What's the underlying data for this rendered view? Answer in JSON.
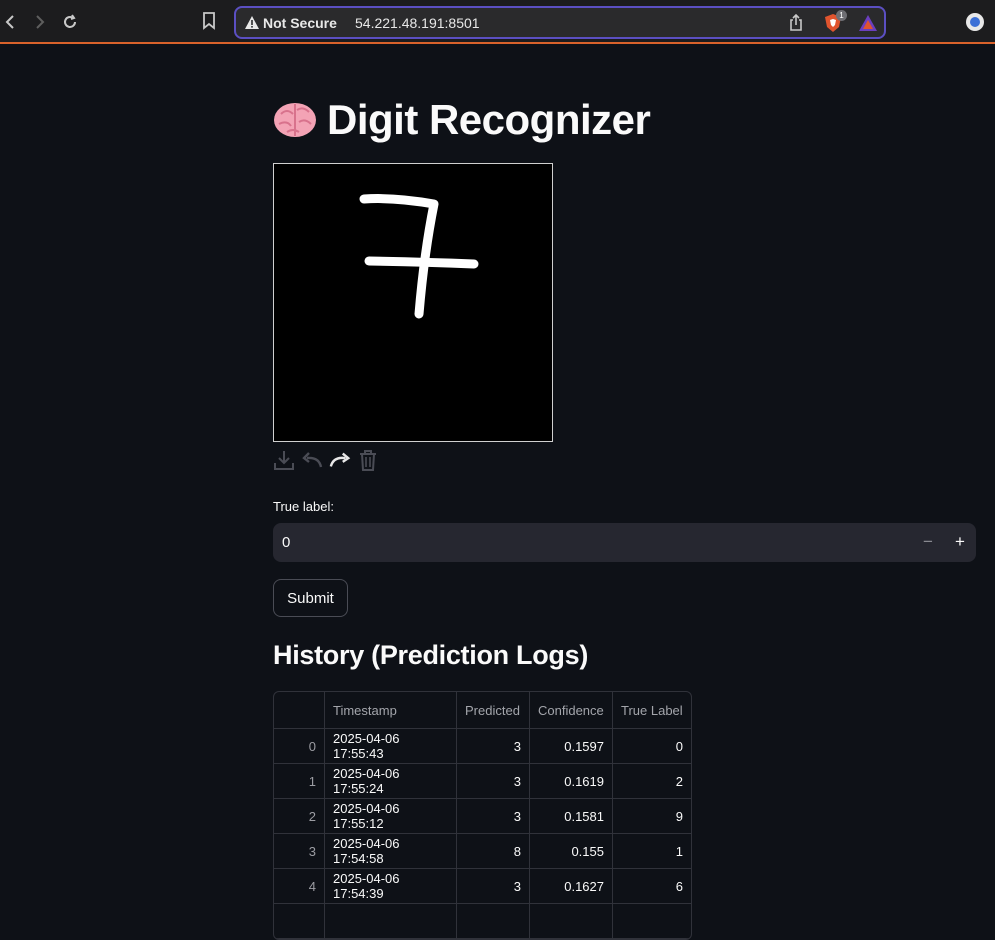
{
  "browser": {
    "security_label": "Not Secure",
    "url": "54.221.48.191:8501",
    "shield_count": "1",
    "accent": "#d9622b"
  },
  "app": {
    "title": "Digit Recognizer",
    "title_icon": "brain-emoji-icon",
    "canvas": {
      "background": "#000000",
      "stroke_color": "#ffffff",
      "drawn_digit": "7"
    },
    "canvas_tools": [
      "download-icon",
      "undo-icon",
      "redo-icon",
      "trash-icon"
    ],
    "true_label": {
      "label": "True label:",
      "value": "0",
      "minus": "−",
      "plus": "+"
    },
    "submit_label": "Submit",
    "history_title": "History (Prediction Logs)",
    "table": {
      "columns": [
        "",
        "Timestamp",
        "Predicted",
        "Confidence",
        "True Label"
      ],
      "rows": [
        [
          "0",
          "2025-04-06 17:55:43",
          "3",
          "0.1597",
          "0"
        ],
        [
          "1",
          "2025-04-06 17:55:24",
          "3",
          "0.1619",
          "2"
        ],
        [
          "2",
          "2025-04-06 17:55:12",
          "3",
          "0.1581",
          "9"
        ],
        [
          "3",
          "2025-04-06 17:54:58",
          "8",
          "0.155",
          "1"
        ],
        [
          "4",
          "2025-04-06 17:54:39",
          "3",
          "0.1627",
          "6"
        ]
      ]
    }
  }
}
